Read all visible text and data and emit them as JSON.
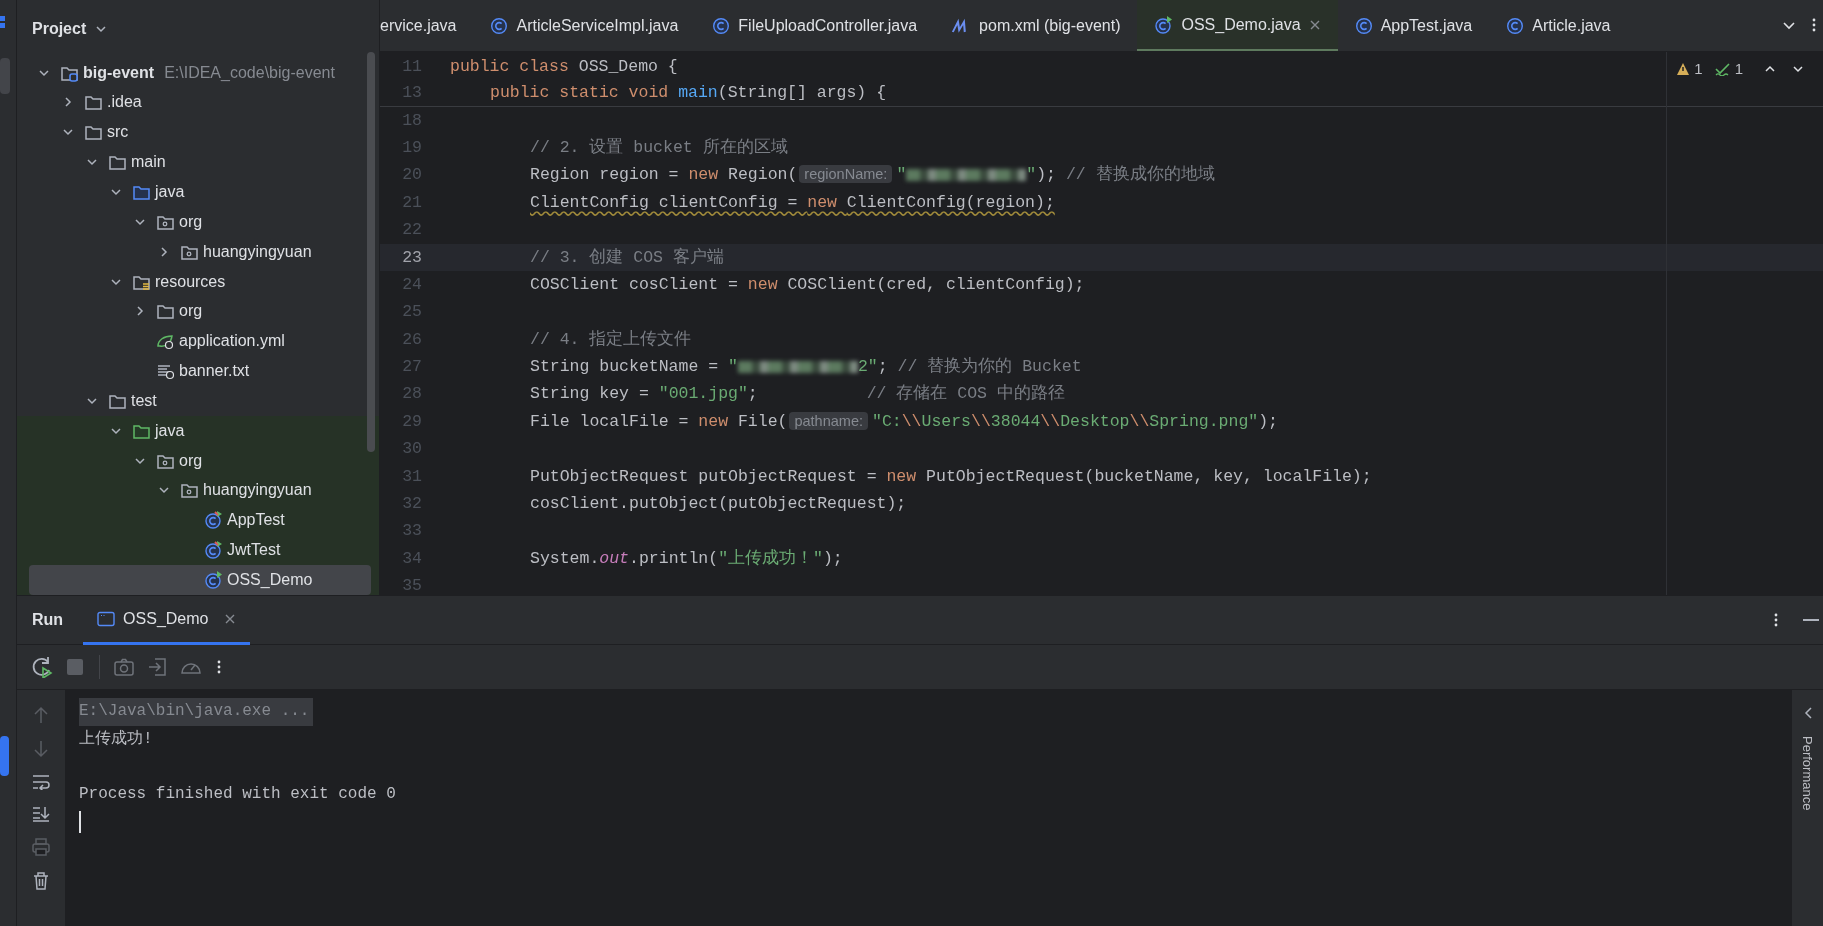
{
  "project_panel": {
    "title": "Project",
    "tree": [
      {
        "label": "big-event",
        "path": "E:\\IDEA_code\\big-event",
        "kind": "module",
        "expanded": true,
        "selected": false,
        "children": [
          {
            "label": ".idea",
            "kind": "folder",
            "expanded": false,
            "selected": false
          },
          {
            "label": "src",
            "kind": "folder",
            "expanded": true,
            "selected": false,
            "children": [
              {
                "label": "main",
                "kind": "folder",
                "expanded": true,
                "selected": false,
                "children": [
                  {
                    "label": "java",
                    "kind": "source-root",
                    "expanded": true,
                    "selected": false,
                    "children": [
                      {
                        "label": "org",
                        "kind": "package",
                        "expanded": true,
                        "selected": false,
                        "children": [
                          {
                            "label": "huangyingyuan",
                            "kind": "package",
                            "expanded": false,
                            "selected": false
                          }
                        ]
                      }
                    ]
                  },
                  {
                    "label": "resources",
                    "kind": "resources-root",
                    "expanded": true,
                    "selected": false,
                    "children": [
                      {
                        "label": "org",
                        "kind": "folder",
                        "expanded": false,
                        "selected": false
                      },
                      {
                        "label": "application.yml",
                        "kind": "spring-file",
                        "selected": false
                      },
                      {
                        "label": "banner.txt",
                        "kind": "text-file",
                        "selected": false
                      }
                    ]
                  }
                ]
              },
              {
                "label": "test",
                "kind": "folder",
                "expanded": true,
                "selected": false,
                "children": [
                  {
                    "label": "java",
                    "kind": "test-root",
                    "expanded": true,
                    "selected": false,
                    "children": [
                      {
                        "label": "org",
                        "kind": "package",
                        "expanded": true,
                        "selected": false,
                        "children": [
                          {
                            "label": "huangyingyuan",
                            "kind": "package",
                            "expanded": true,
                            "selected": false,
                            "children": [
                              {
                                "label": "AppTest",
                                "kind": "test-class",
                                "selected": false
                              },
                              {
                                "label": "JwtTest",
                                "kind": "test-class",
                                "selected": false
                              },
                              {
                                "label": "OSS_Demo",
                                "kind": "run-class",
                                "selected": true
                              }
                            ]
                          }
                        ]
                      }
                    ]
                  }
                ]
              }
            ]
          }
        ]
      }
    ]
  },
  "editor_tabs": [
    {
      "label": "ervice.java",
      "selected": false
    },
    {
      "label": "ArticleServiceImpl.java",
      "kind": "class",
      "selected": false
    },
    {
      "label": "FileUploadController.java",
      "kind": "class",
      "selected": false
    },
    {
      "label": "pom.xml (big-event)",
      "kind": "maven",
      "selected": false
    },
    {
      "label": "OSS_Demo.java",
      "kind": "run-class",
      "selected": true
    },
    {
      "label": "AppTest.java",
      "kind": "class",
      "selected": false
    },
    {
      "label": "Article.java",
      "kind": "class",
      "selected": false
    }
  ],
  "inspections": {
    "warnings": "1",
    "weak_warnings": "1"
  },
  "sticky_lines": [
    {
      "number": "11",
      "kind": "class",
      "segments": [
        {
          "kind": "keyword",
          "text": "public class "
        },
        {
          "kind": "plain",
          "text": "OSS_Demo {"
        }
      ]
    },
    {
      "number": "13",
      "kind": "member",
      "segments": [
        {
          "kind": "keyword",
          "text": "public static void "
        },
        {
          "kind": "method",
          "text": "main"
        },
        {
          "kind": "plain",
          "text": "(String[] args) {"
        }
      ]
    }
  ],
  "code_lines": [
    {
      "number": "18",
      "current": false
    },
    {
      "number": "19",
      "current": false,
      "kind": "body",
      "segments": [
        {
          "kind": "comment",
          "text": "// 2. 设置 bucket 所在的区域"
        }
      ]
    },
    {
      "number": "20",
      "current": false,
      "kind": "body",
      "segments": [
        {
          "kind": "plain",
          "text": "Region region = "
        },
        {
          "kind": "keyword",
          "text": "new "
        },
        {
          "kind": "plain",
          "text": "Region("
        },
        {
          "kind": "hint",
          "text": "regionName:"
        },
        {
          "kind": "string",
          "text": "\""
        },
        {
          "kind": "redacted"
        },
        {
          "kind": "string",
          "text": "\""
        },
        {
          "kind": "plain",
          "text": "); "
        },
        {
          "kind": "comment",
          "text": "// 替换成你的地域"
        }
      ]
    },
    {
      "number": "21",
      "current": false,
      "kind": "body",
      "segments": [
        {
          "kind": "warning",
          "text": "ClientConfig clientConfig = "
        },
        {
          "kind": "warning-keyword",
          "text": "new "
        },
        {
          "kind": "warning",
          "text": "ClientConfig(region);"
        }
      ]
    },
    {
      "number": "22",
      "current": false
    },
    {
      "number": "23",
      "current": true,
      "kind": "body",
      "segments": [
        {
          "kind": "comment",
          "text": "// 3. 创建 COS 客户端"
        }
      ]
    },
    {
      "number": "24",
      "current": false,
      "kind": "body",
      "segments": [
        {
          "kind": "plain",
          "text": "COSClient cosClient = "
        },
        {
          "kind": "keyword",
          "text": "new "
        },
        {
          "kind": "plain",
          "text": "COSClient(cred, clientConfig);"
        }
      ]
    },
    {
      "number": "25",
      "current": false
    },
    {
      "number": "26",
      "current": false,
      "kind": "body",
      "segments": [
        {
          "kind": "comment",
          "text": "// 4. 指定上传文件"
        }
      ]
    },
    {
      "number": "27",
      "current": false,
      "kind": "body",
      "segments": [
        {
          "kind": "plain",
          "text": "String bucketName = "
        },
        {
          "kind": "string",
          "text": "\""
        },
        {
          "kind": "redacted"
        },
        {
          "kind": "string",
          "text": "2\""
        },
        {
          "kind": "plain",
          "text": "; "
        },
        {
          "kind": "comment",
          "text": "// 替换为你的 Bucket"
        }
      ]
    },
    {
      "number": "28",
      "current": false,
      "kind": "body",
      "segments": [
        {
          "kind": "plain",
          "text": "String key = "
        },
        {
          "kind": "string",
          "text": "\"001.jpg\""
        },
        {
          "kind": "plain",
          "text": ";           "
        },
        {
          "kind": "comment",
          "text": "// 存储在 COS 中的路径"
        }
      ]
    },
    {
      "number": "29",
      "current": false,
      "kind": "body",
      "segments": [
        {
          "kind": "plain",
          "text": "File localFile = "
        },
        {
          "kind": "keyword",
          "text": "new "
        },
        {
          "kind": "plain",
          "text": "File("
        },
        {
          "kind": "hint",
          "text": "pathname:"
        },
        {
          "kind": "string",
          "text": "\"C:"
        },
        {
          "kind": "escape",
          "text": "\\\\"
        },
        {
          "kind": "string",
          "text": "Users"
        },
        {
          "kind": "escape",
          "text": "\\\\"
        },
        {
          "kind": "string",
          "text": "38044"
        },
        {
          "kind": "escape",
          "text": "\\\\"
        },
        {
          "kind": "string",
          "text": "Desktop"
        },
        {
          "kind": "escape",
          "text": "\\\\"
        },
        {
          "kind": "string",
          "text": "Spring.png\""
        },
        {
          "kind": "plain",
          "text": ");"
        }
      ]
    },
    {
      "number": "30",
      "current": false
    },
    {
      "number": "31",
      "current": false,
      "kind": "body",
      "segments": [
        {
          "kind": "plain",
          "text": "PutObjectRequest putObjectRequest = "
        },
        {
          "kind": "keyword",
          "text": "new "
        },
        {
          "kind": "plain",
          "text": "PutObjectRequest(bucketName, key, localFile);"
        }
      ]
    },
    {
      "number": "32",
      "current": false,
      "kind": "body",
      "segments": [
        {
          "kind": "plain",
          "text": "cosClient.putObject(putObjectRequest);"
        }
      ]
    },
    {
      "number": "33",
      "current": false
    },
    {
      "number": "34",
      "current": false,
      "kind": "body",
      "segments": [
        {
          "kind": "plain",
          "text": "System."
        },
        {
          "kind": "field",
          "text": "out"
        },
        {
          "kind": "plain",
          "text": ".println("
        },
        {
          "kind": "string",
          "text": "\"上传成功！\""
        },
        {
          "kind": "plain",
          "text": ");"
        }
      ]
    },
    {
      "number": "35",
      "current": false
    }
  ],
  "run_panel": {
    "title": "Run",
    "tabs": [
      {
        "label": "OSS_Demo",
        "selected": true
      }
    ],
    "console": [
      {
        "kind": "command",
        "text": "E:\\Java\\bin\\java.exe ..."
      },
      {
        "kind": "output",
        "text": "上传成功!"
      },
      {
        "kind": "blank"
      },
      {
        "kind": "output",
        "text": "Process finished with exit code 0"
      }
    ],
    "side_tab": "Performance"
  }
}
